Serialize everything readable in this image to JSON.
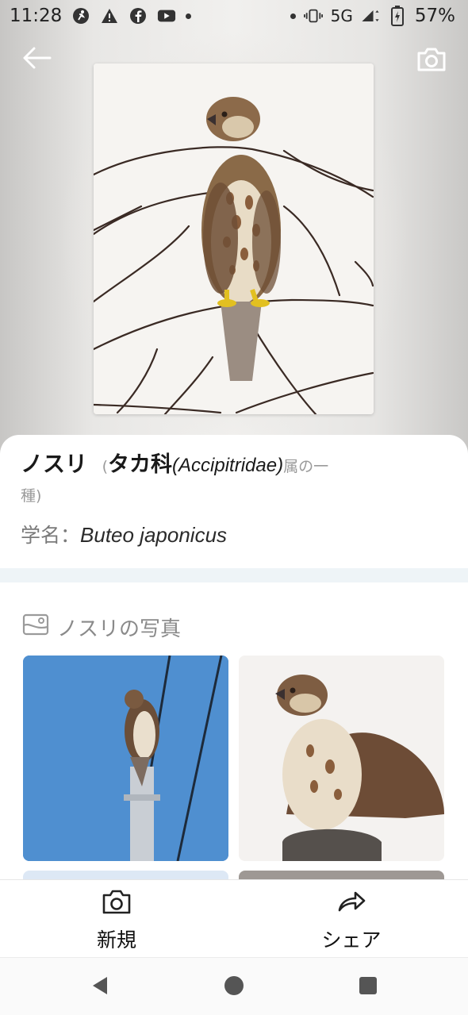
{
  "status_bar": {
    "time": "11:28",
    "network": "5G",
    "battery": "57%",
    "left_icons": [
      "fitness-icon",
      "warning-icon",
      "facebook-icon",
      "youtube-icon",
      "dot-icon"
    ],
    "right_icons": [
      "dot-icon",
      "vibrate-icon",
      "signal-icon",
      "battery-icon"
    ]
  },
  "header": {
    "back_icon": "arrow-left-icon",
    "camera_icon": "camera-icon"
  },
  "species": {
    "name_jp": "ノスリ",
    "paren_open": "(",
    "family_jp": "タカ科",
    "family_latin": "(Accipitridae)",
    "genus_suffix": "属の一",
    "genus_suffix_line2": "種)",
    "scientific_label": "学名：",
    "scientific_name": "Buteo japonicus"
  },
  "photos": {
    "heading": "ノスリの写真",
    "heading_icon": "photo-card-icon"
  },
  "actions": {
    "new_label": "新規",
    "share_label": "シェア",
    "new_icon": "camera-icon",
    "share_icon": "share-arrow-icon"
  },
  "colors": {
    "accent_band": "#eef4f7",
    "sky_blue": "#4f8fd0",
    "text_gray": "#8a8a8a"
  }
}
